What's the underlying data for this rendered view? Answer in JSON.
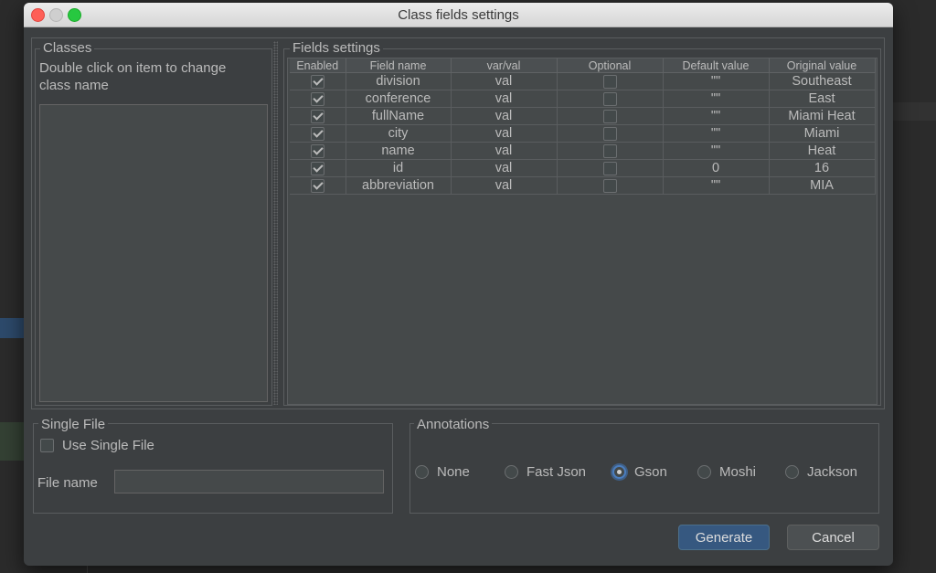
{
  "window": {
    "title": "Class fields settings"
  },
  "classes": {
    "label": "Classes",
    "hint": "Double click on item to change class name"
  },
  "fields": {
    "label": "Fields settings",
    "columns": [
      "Enabled",
      "Field name",
      "var/val",
      "Optional",
      "Default value",
      "Original value"
    ],
    "rows": [
      {
        "enabled": true,
        "name": "division",
        "varval": "val",
        "optional": false,
        "default": "\"\"",
        "original": "Southeast"
      },
      {
        "enabled": true,
        "name": "conference",
        "varval": "val",
        "optional": false,
        "default": "\"\"",
        "original": "East"
      },
      {
        "enabled": true,
        "name": "fullName",
        "varval": "val",
        "optional": false,
        "default": "\"\"",
        "original": "Miami Heat"
      },
      {
        "enabled": true,
        "name": "city",
        "varval": "val",
        "optional": false,
        "default": "\"\"",
        "original": "Miami"
      },
      {
        "enabled": true,
        "name": "name",
        "varval": "val",
        "optional": false,
        "default": "\"\"",
        "original": "Heat"
      },
      {
        "enabled": true,
        "name": "id",
        "varval": "val",
        "optional": false,
        "default": "0",
        "original": "16"
      },
      {
        "enabled": true,
        "name": "abbreviation",
        "varval": "val",
        "optional": false,
        "default": "\"\"",
        "original": "MIA"
      }
    ]
  },
  "single_file": {
    "label": "Single File",
    "checkbox_label": "Use Single File",
    "checked": false,
    "file_name_label": "File name",
    "file_name_value": ""
  },
  "annotations": {
    "label": "Annotations",
    "options": [
      "None",
      "Fast Json",
      "Gson",
      "Moshi",
      "Jackson"
    ],
    "selected": "Gson"
  },
  "buttons": {
    "generate": "Generate",
    "cancel": "Cancel"
  },
  "colors": {
    "dialog_bg": "#3c3f41",
    "primary_button": "#365880",
    "radio_selected": "#4b7ebf"
  }
}
